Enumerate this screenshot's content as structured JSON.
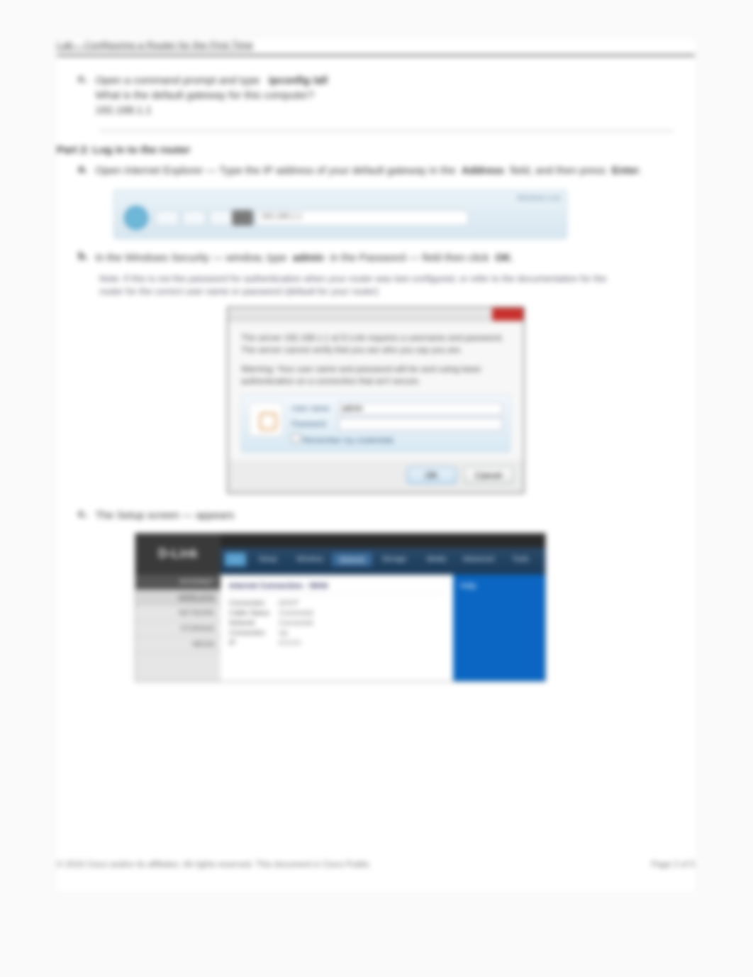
{
  "header": "Lab – Configuring a Router for the First Time",
  "steps": {
    "s1_num": "c.",
    "s1_text_a": "Open a command prompt and type",
    "s1_cmd": "ipconfig /all",
    "s1_text_b": "What is the default gateway for this computer?",
    "s1_ans": "192.168.1.1",
    "part_label": "Part 2:    Log in to the router",
    "s2_num": "a.",
    "s2_text_a": "Open Internet Explorer — Type the IP address of your default gateway in the",
    "s2_bold_a": "Address",
    "s2_text_b": "field, and then press",
    "s2_bold_b": "Enter",
    "s3_num": "b.",
    "s3_text_a": "In the Windows Security — window, type",
    "s3_bold_a": "admin",
    "s3_text_b": "in the Password — field then click",
    "s3_bold_b": "OK",
    "note": "Note: If this is not the password for authentication when your router was last configured, or refer to the documentation for the router for the correct user name or password (default for your router)",
    "s4_num": "c.",
    "s4_text": "The Setup screen — appears"
  },
  "browser": {
    "url": "192.168.1.1",
    "corner": "Windows Live"
  },
  "dialog": {
    "msg1": "The server 192.168.1.1 at D-Link requires a username and password. The server cannot verify that you are who you say you are.",
    "msg2": "Warning: Your user name and password will be sent using basic authentication on a connection that isn't secure.",
    "user_label": "User name",
    "pass_label": "Password",
    "user_value": "admin",
    "remember": "Remember my credentials",
    "ok": "OK",
    "cancel": "Cancel"
  },
  "router": {
    "brand": "D-Link",
    "tabs": [
      "Setup",
      "Wireless",
      "Network",
      "Storage",
      "Media",
      "Advanced",
      "Tools"
    ],
    "side": [
      "INTERNET",
      "WIRELESS",
      "NETWORK",
      "STORAGE",
      "MEDIA"
    ],
    "panel_title": "Internet Connection - WAN",
    "rows": [
      [
        "Connection",
        "DHCP"
      ],
      [
        "Cable Status",
        "Connected"
      ],
      [
        "Network",
        "Connected"
      ],
      [
        "Connection",
        "Up"
      ],
      [
        "IP",
        "0.0.0.0"
      ]
    ],
    "help": "Help"
  },
  "footer": {
    "left": "© 2016 Cisco and/or its affiliates. All rights reserved. This document is Cisco Public.",
    "right": "Page 2 of 5"
  }
}
